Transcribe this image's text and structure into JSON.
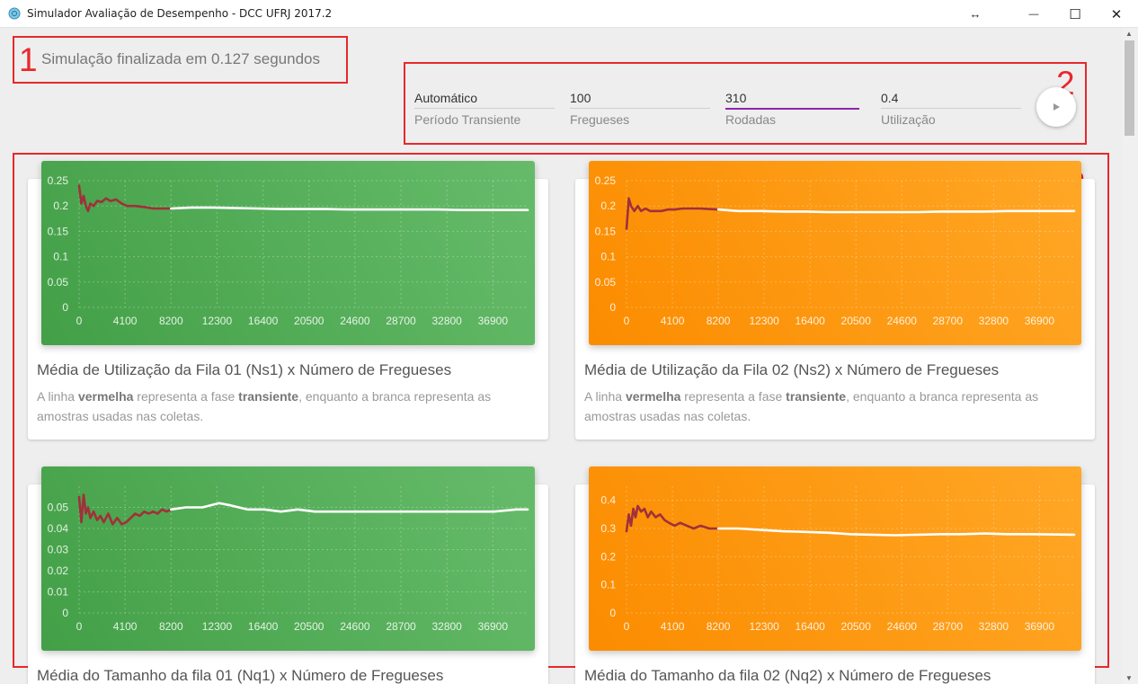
{
  "window": {
    "title": "Simulador Avaliação de Desempenho - DCC UFRJ 2017.2",
    "resize_glyph": "↔",
    "minimize_glyph": "—",
    "maximize_glyph": "☐",
    "close_glyph": "✕"
  },
  "annotations": [
    "1",
    "2",
    "3"
  ],
  "status": {
    "text": "Simulação finalizada em 0.127 segundos"
  },
  "controls": {
    "fields": [
      {
        "value": "Automático",
        "label": "Período Transiente"
      },
      {
        "value": "100",
        "label": "Fregueses"
      },
      {
        "value": "310",
        "label": "Rodadas"
      },
      {
        "value": "0.4",
        "label": "Utilização"
      }
    ],
    "run_icon": "play-icon"
  },
  "description": {
    "p1": "A linha ",
    "b1": "vermelha",
    "p2": " representa a fase ",
    "b2": "transiente",
    "p3": ", enquanto a branca representa as amostras usadas nas coletas."
  },
  "colors": {
    "green": "#4caf50",
    "orange": "#ff9800",
    "transient": "#a1303a",
    "samples": "#ffffff",
    "annotation": "#e8282c",
    "active_field": "#8e24aa"
  },
  "chart_data": [
    {
      "type": "line",
      "title": "Média de Utilização da Fila 01 (Ns1) x Número de Fregueses",
      "xlabel": "",
      "ylabel": "",
      "x_ticks": [
        "0",
        "4100",
        "8200",
        "12300",
        "16400",
        "20500",
        "24600",
        "28700",
        "32800",
        "36900"
      ],
      "y_ticks": [
        "0",
        "0.05",
        "0.1",
        "0.15",
        "0.2",
        "0.25"
      ],
      "xlim": [
        0,
        40000
      ],
      "ylim": [
        0,
        0.25
      ],
      "grid": true,
      "series": [
        {
          "role": "transient",
          "color": "#a1303a",
          "x": [
            0,
            200,
            400,
            600,
            800,
            1000,
            1300,
            1600,
            2000,
            2400,
            2800,
            3300,
            3800,
            4300,
            5000,
            5800,
            6600,
            7400,
            8200
          ],
          "y": [
            0.24,
            0.205,
            0.22,
            0.2,
            0.19,
            0.205,
            0.2,
            0.21,
            0.208,
            0.215,
            0.21,
            0.213,
            0.205,
            0.2,
            0.2,
            0.198,
            0.195,
            0.195,
            0.195
          ]
        },
        {
          "role": "samples",
          "color": "#ffffff",
          "x": [
            8200,
            10000,
            12000,
            14000,
            16000,
            18000,
            20000,
            22000,
            24000,
            26000,
            28000,
            30000,
            32000,
            34000,
            36000,
            38000,
            40000
          ],
          "y": [
            0.195,
            0.197,
            0.197,
            0.196,
            0.195,
            0.194,
            0.194,
            0.194,
            0.193,
            0.193,
            0.193,
            0.193,
            0.193,
            0.192,
            0.192,
            0.192,
            0.192
          ]
        }
      ]
    },
    {
      "type": "line",
      "title": "Média de Utilização da Fila 02 (Ns2) x Número de Fregueses",
      "xlabel": "",
      "ylabel": "",
      "x_ticks": [
        "0",
        "4100",
        "8200",
        "12300",
        "16400",
        "20500",
        "24600",
        "28700",
        "32800",
        "36900"
      ],
      "y_ticks": [
        "0",
        "0.05",
        "0.1",
        "0.15",
        "0.2",
        "0.25"
      ],
      "xlim": [
        0,
        40000
      ],
      "ylim": [
        0,
        0.25
      ],
      "grid": true,
      "series": [
        {
          "role": "transient",
          "color": "#a1303a",
          "x": [
            0,
            200,
            400,
            700,
            1000,
            1300,
            1700,
            2100,
            2600,
            3100,
            3700,
            4300,
            5000,
            5800,
            6600,
            7400,
            8200
          ],
          "y": [
            0.155,
            0.215,
            0.2,
            0.19,
            0.2,
            0.19,
            0.195,
            0.19,
            0.19,
            0.19,
            0.193,
            0.193,
            0.195,
            0.195,
            0.195,
            0.194,
            0.193
          ]
        },
        {
          "role": "samples",
          "color": "#ffffff",
          "x": [
            8200,
            10000,
            12000,
            14000,
            16000,
            18000,
            20000,
            22000,
            24000,
            26000,
            28000,
            30000,
            32000,
            34000,
            36000,
            38000,
            40000
          ],
          "y": [
            0.193,
            0.19,
            0.19,
            0.189,
            0.189,
            0.188,
            0.188,
            0.188,
            0.188,
            0.188,
            0.189,
            0.189,
            0.189,
            0.19,
            0.19,
            0.19,
            0.19
          ]
        }
      ]
    },
    {
      "type": "line",
      "title": "Média do Tamanho da fila 01 (Nq1) x Número de Fregueses",
      "xlabel": "",
      "ylabel": "",
      "x_ticks": [
        "0",
        "4100",
        "8200",
        "12300",
        "16400",
        "20500",
        "24600",
        "28700",
        "32800",
        "36900"
      ],
      "y_ticks": [
        "0",
        "0.01",
        "0.02",
        "0.03",
        "0.04",
        "0.05"
      ],
      "xlim": [
        0,
        40000
      ],
      "ylim": [
        0,
        0.06
      ],
      "grid": true,
      "series": [
        {
          "role": "transient",
          "color": "#a1303a",
          "x": [
            0,
            200,
            400,
            600,
            800,
            1000,
            1300,
            1600,
            1900,
            2200,
            2600,
            3000,
            3400,
            3800,
            4200,
            4600,
            5000,
            5400,
            5800,
            6200,
            6600,
            7000,
            7400,
            7800,
            8200
          ],
          "y": [
            0.055,
            0.043,
            0.056,
            0.047,
            0.05,
            0.045,
            0.048,
            0.044,
            0.046,
            0.043,
            0.047,
            0.042,
            0.045,
            0.042,
            0.043,
            0.045,
            0.047,
            0.046,
            0.048,
            0.047,
            0.048,
            0.047,
            0.049,
            0.048,
            0.049
          ]
        },
        {
          "role": "samples",
          "color": "#ffffff",
          "x": [
            8200,
            9500,
            11000,
            12500,
            13500,
            15000,
            16500,
            18000,
            19500,
            21000,
            23000,
            25000,
            27000,
            29000,
            31000,
            33000,
            35000,
            37000,
            39000,
            40000
          ],
          "y": [
            0.049,
            0.05,
            0.05,
            0.052,
            0.051,
            0.049,
            0.049,
            0.048,
            0.049,
            0.048,
            0.048,
            0.048,
            0.048,
            0.048,
            0.048,
            0.048,
            0.048,
            0.048,
            0.049,
            0.049
          ]
        }
      ]
    },
    {
      "type": "line",
      "title": "Média do Tamanho da fila 02 (Nq2) x Número de Fregueses",
      "xlabel": "",
      "ylabel": "",
      "x_ticks": [
        "0",
        "4100",
        "8200",
        "12300",
        "16400",
        "20500",
        "24600",
        "28700",
        "32800",
        "36900"
      ],
      "y_ticks": [
        "0",
        "0.1",
        "0.2",
        "0.3",
        "0.4"
      ],
      "xlim": [
        0,
        40000
      ],
      "ylim": [
        0,
        0.45
      ],
      "grid": true,
      "series": [
        {
          "role": "transient",
          "color": "#a1303a",
          "x": [
            0,
            200,
            400,
            600,
            800,
            1000,
            1300,
            1600,
            1900,
            2200,
            2600,
            3000,
            3400,
            3800,
            4300,
            4800,
            5400,
            6000,
            6600,
            7400,
            8200
          ],
          "y": [
            0.29,
            0.35,
            0.31,
            0.37,
            0.34,
            0.38,
            0.36,
            0.37,
            0.34,
            0.36,
            0.34,
            0.35,
            0.33,
            0.32,
            0.31,
            0.32,
            0.31,
            0.3,
            0.31,
            0.3,
            0.3
          ]
        },
        {
          "role": "samples",
          "color": "#ffffff",
          "x": [
            8200,
            10000,
            12000,
            14000,
            16000,
            18000,
            20000,
            22000,
            24000,
            26000,
            28000,
            30000,
            32000,
            34000,
            36000,
            38000,
            40000
          ],
          "y": [
            0.3,
            0.3,
            0.295,
            0.29,
            0.288,
            0.285,
            0.28,
            0.278,
            0.276,
            0.278,
            0.28,
            0.28,
            0.282,
            0.28,
            0.28,
            0.279,
            0.278
          ]
        }
      ]
    }
  ]
}
